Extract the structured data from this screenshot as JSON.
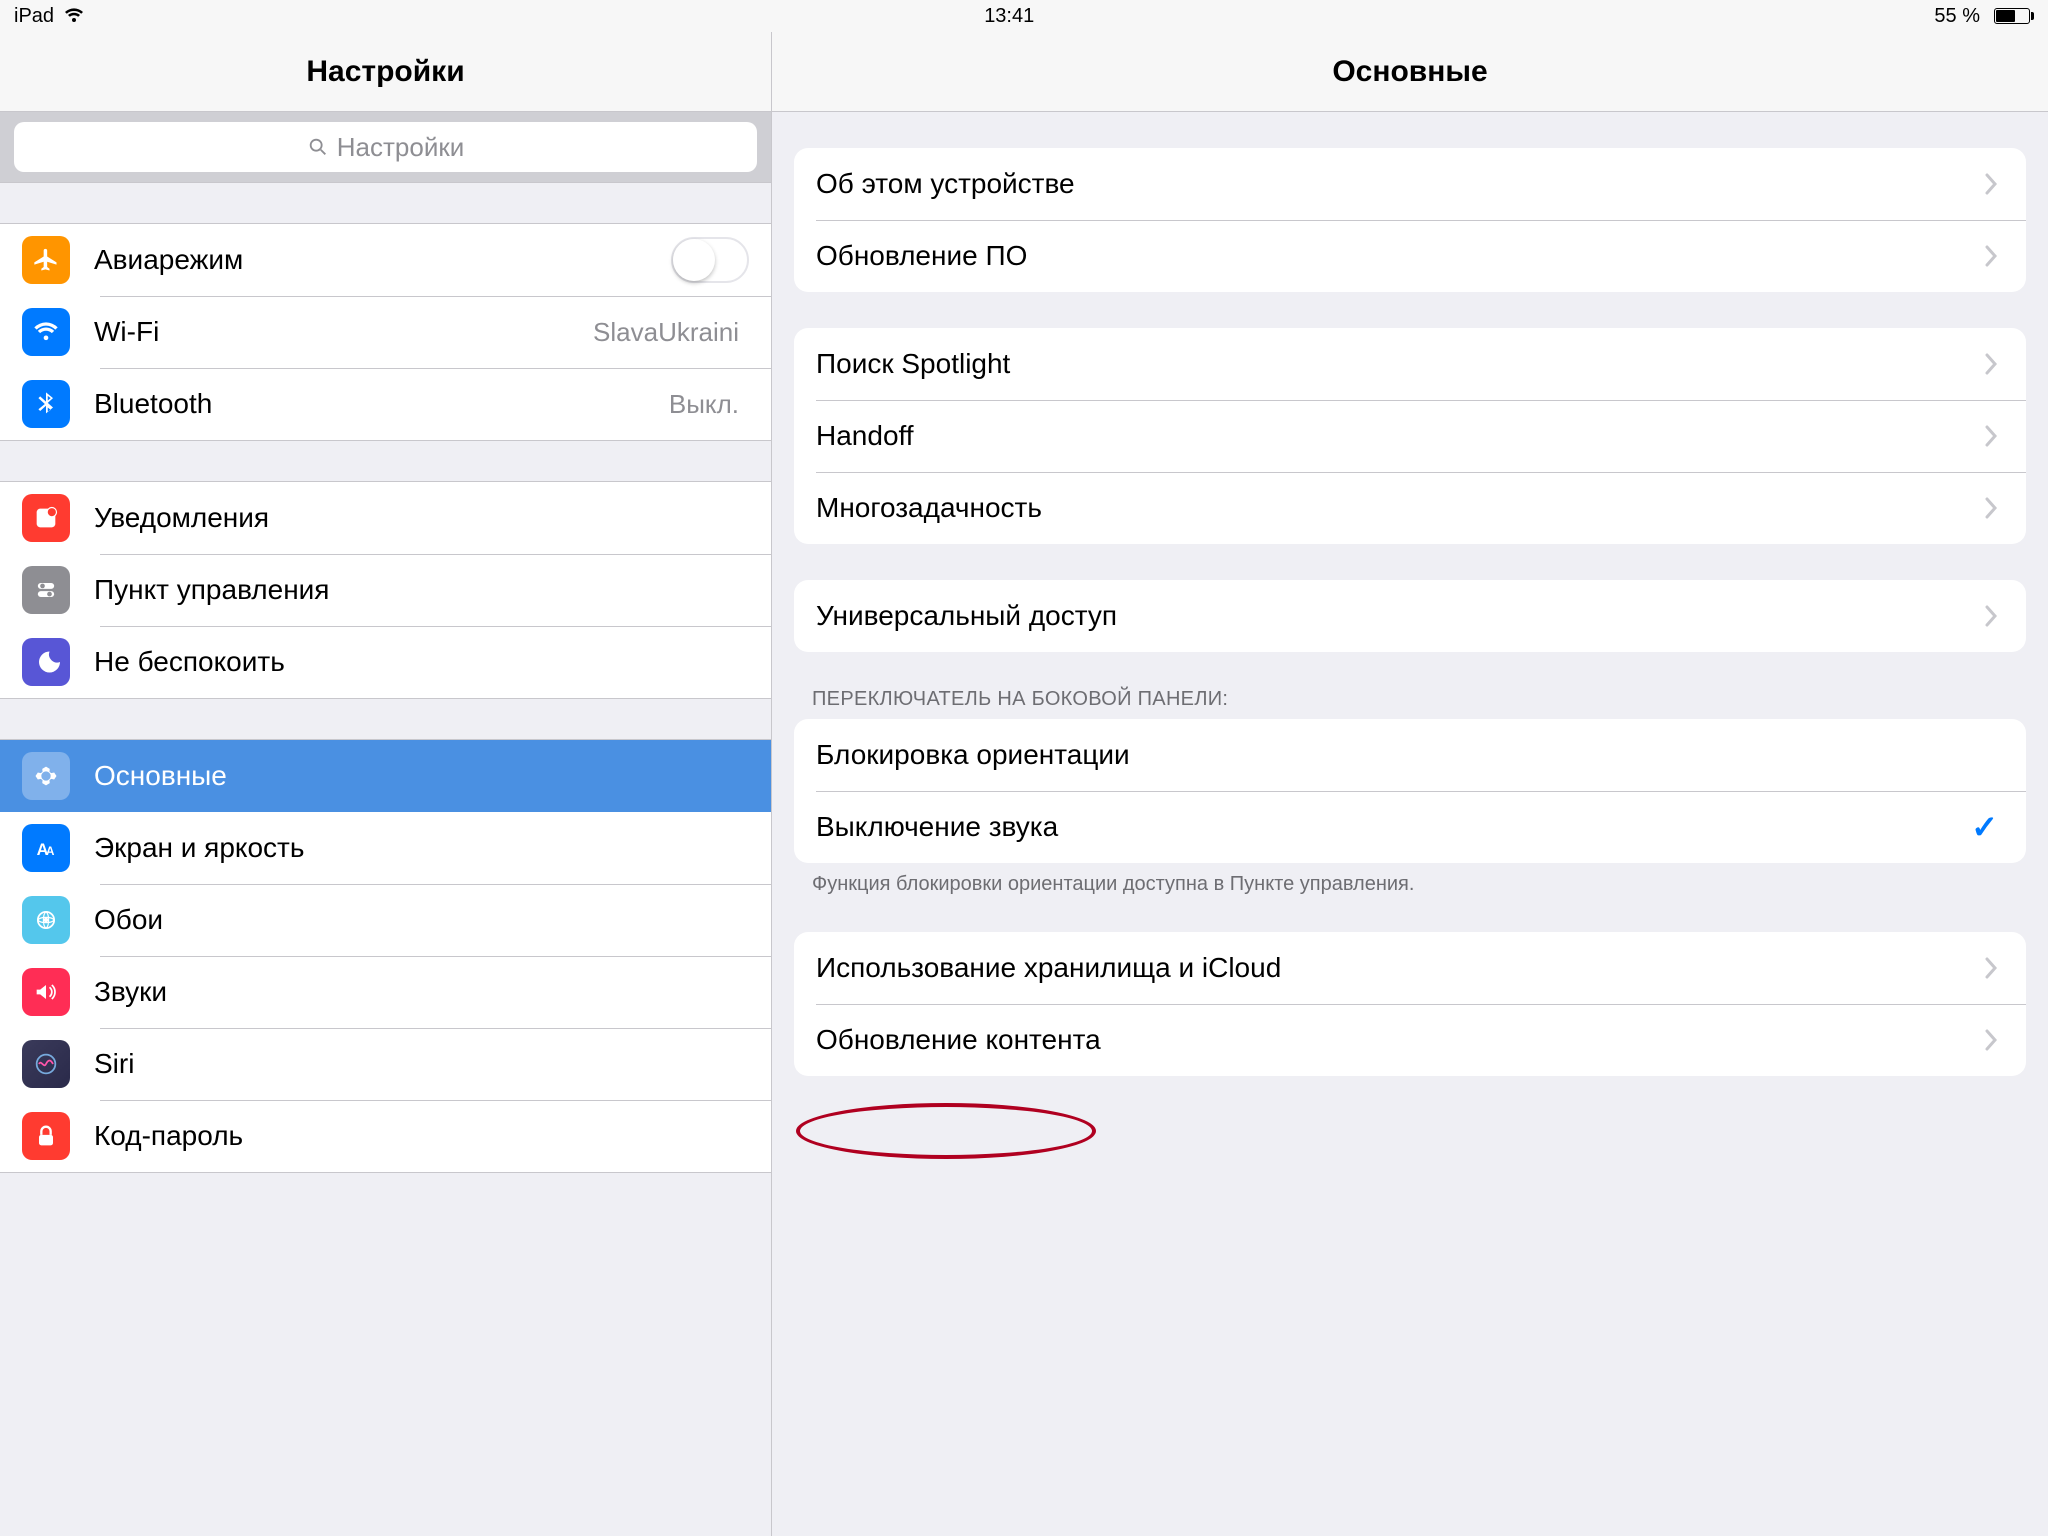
{
  "statusbar": {
    "device": "iPad",
    "time": "13:41",
    "battery_text": "55 %"
  },
  "sidebar": {
    "title": "Настройки",
    "search_placeholder": "Настройки",
    "groups": [
      {
        "items": [
          {
            "id": "airplane",
            "label": "Авиарежим",
            "has_toggle": true
          },
          {
            "id": "wifi",
            "label": "Wi-Fi",
            "value": "SlavaUkraini"
          },
          {
            "id": "bt",
            "label": "Bluetooth",
            "value": "Выкл."
          }
        ]
      },
      {
        "items": [
          {
            "id": "notif",
            "label": "Уведомления"
          },
          {
            "id": "control",
            "label": "Пункт управления"
          },
          {
            "id": "dnd",
            "label": "Не беспокоить"
          }
        ]
      },
      {
        "items": [
          {
            "id": "general",
            "label": "Основные",
            "selected": true
          },
          {
            "id": "display",
            "label": "Экран и яркость"
          },
          {
            "id": "wall",
            "label": "Обои"
          },
          {
            "id": "sound",
            "label": "Звуки"
          },
          {
            "id": "siri",
            "label": "Siri"
          },
          {
            "id": "pass",
            "label": "Код-пароль"
          }
        ]
      }
    ]
  },
  "detail": {
    "title": "Основные",
    "sections": [
      {
        "rows": [
          {
            "label": "Об этом устройстве"
          },
          {
            "label": "Обновление ПО"
          }
        ]
      },
      {
        "rows": [
          {
            "label": "Поиск Spotlight"
          },
          {
            "label": "Handoff"
          },
          {
            "label": "Многозадачность"
          }
        ]
      },
      {
        "rows": [
          {
            "label": "Универсальный доступ"
          }
        ]
      },
      {
        "header": "ПЕРЕКЛЮЧАТЕЛЬ НА БОКОВОЙ ПАНЕЛИ:",
        "footer": "Функция блокировки ориентации доступна в Пункте управления.",
        "rows": [
          {
            "label": "Блокировка ориентации"
          },
          {
            "label": "Выключение звука",
            "checked": true
          }
        ]
      },
      {
        "rows": [
          {
            "label": "Использование хранилища и iCloud"
          },
          {
            "label": "Обновление контента"
          }
        ]
      }
    ]
  }
}
